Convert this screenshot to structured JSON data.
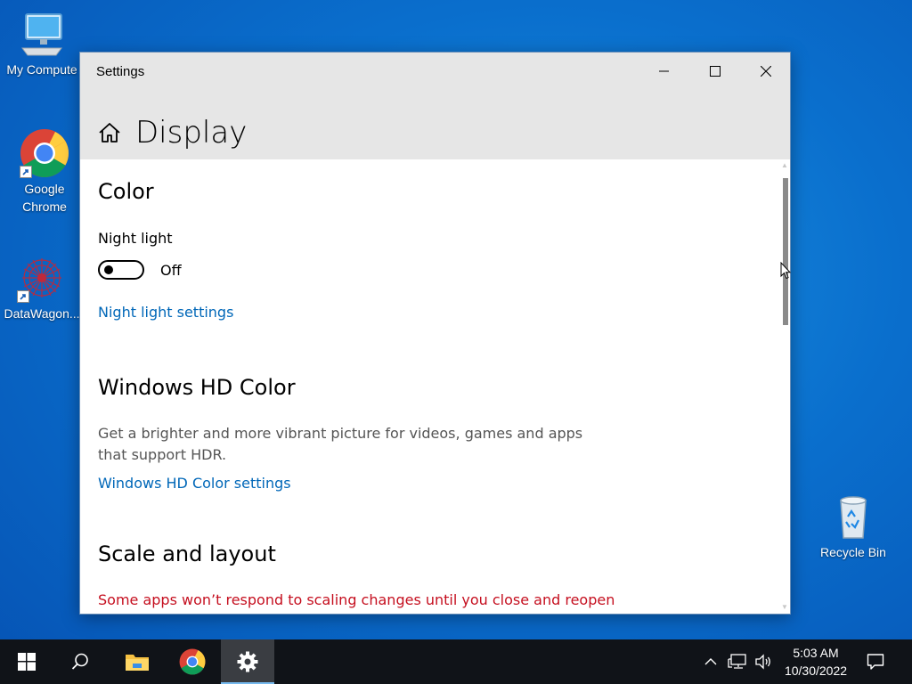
{
  "desktop": {
    "icons": [
      {
        "label": "My Compute"
      },
      {
        "label": "Google Chrome"
      },
      {
        "label": "DataWagon..."
      },
      {
        "label": "Recycle Bin"
      }
    ]
  },
  "window": {
    "title": "Settings",
    "page_title": "Display"
  },
  "content": {
    "color_heading": "Color",
    "night_light_label": "Night light",
    "night_light_state": "Off",
    "night_light_settings_link": "Night light settings",
    "hd_heading": "Windows HD Color",
    "hd_description": "Get a brighter and more vibrant picture for videos, games and apps that support HDR.",
    "hd_settings_link": "Windows HD Color settings",
    "scale_heading": "Scale and layout",
    "scale_warning": "Some apps won’t respond to scaling changes until you close and reopen"
  },
  "taskbar": {
    "time": "5:03 AM",
    "date": "10/30/2022"
  },
  "colors": {
    "accent_link": "#0067b8",
    "warning": "#c50f1f",
    "taskbar": "#101318"
  }
}
